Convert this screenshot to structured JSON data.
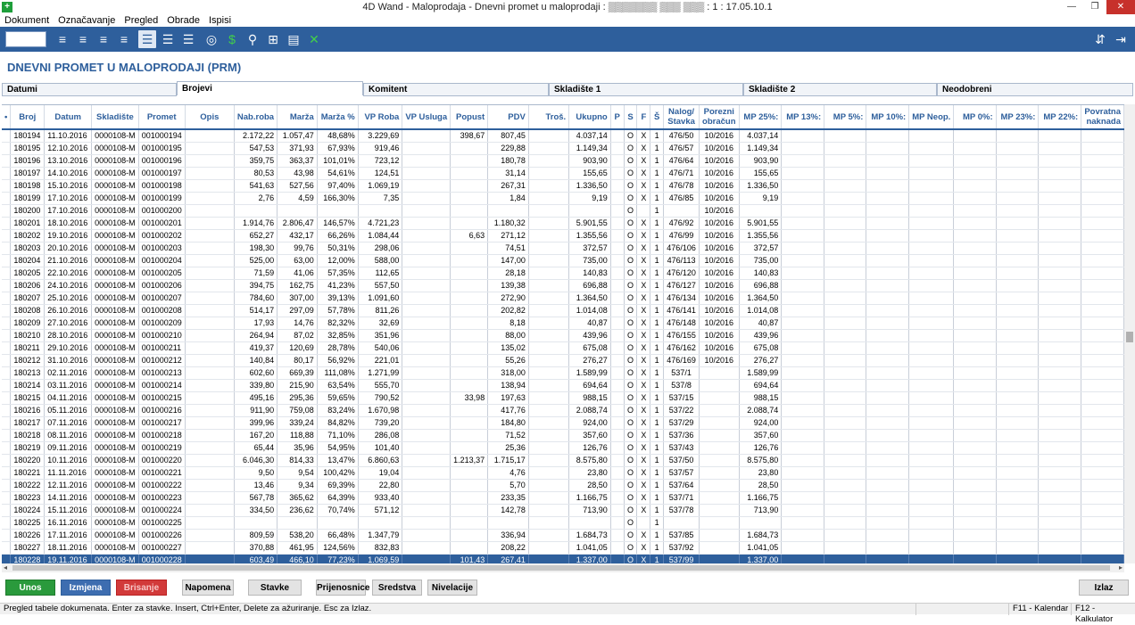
{
  "window": {
    "title": "4D Wand - Maloprodaja - Dnevni promet u maloprodaji : ▒▒▒▒▒▒▒ ▒▒▒ ▒▒▒ : 1 : 17.05.10.1"
  },
  "menu": [
    "Dokument",
    "Označavanje",
    "Pregled",
    "Obrade",
    "Ispisi"
  ],
  "page_title": "DNEVNI PROMET U MALOPRODAJI (PRM)",
  "tabs": [
    {
      "label": "Datumi",
      "w": 196
    },
    {
      "label": "Brojevi",
      "w": 209,
      "active": true
    },
    {
      "label": "Komitent",
      "w": 208
    },
    {
      "label": "Skladište 1",
      "w": 218
    },
    {
      "label": "Skladište 2",
      "w": 217
    },
    {
      "label": "Neodobreni",
      "w": 220
    }
  ],
  "columns": [
    {
      "label": "•",
      "w": 9
    },
    {
      "label": "Broj",
      "w": 38
    },
    {
      "label": "Datum",
      "w": 53
    },
    {
      "label": "Skladište",
      "w": 48
    },
    {
      "label": "Promet",
      "w": 49
    },
    {
      "label": "Opis",
      "w": 58
    },
    {
      "label": "Nab.roba",
      "w": 48
    },
    {
      "label": "Marža",
      "w": 45
    },
    {
      "label": "Marža %",
      "w": 46
    },
    {
      "label": "VP Roba",
      "w": 50
    },
    {
      "label": "VP Usluga",
      "w": 46
    },
    {
      "label": "Popust",
      "w": 41
    },
    {
      "label": "PDV",
      "w": 46
    },
    {
      "label": "Troš.",
      "w": 47
    },
    {
      "label": "Ukupno",
      "w": 47
    },
    {
      "label": "P",
      "w": 15
    },
    {
      "label": "S",
      "w": 15
    },
    {
      "label": "F",
      "w": 15
    },
    {
      "label": "Š",
      "w": 15
    },
    {
      "label": "Nalog/\nStavka",
      "w": 40
    },
    {
      "label": "Porezni\nobračun",
      "w": 42
    },
    {
      "label": "MP 25%:",
      "w": 48
    },
    {
      "label": "MP 13%:",
      "w": 48
    },
    {
      "label": "MP 5%:",
      "w": 48
    },
    {
      "label": "MP 10%:",
      "w": 48
    },
    {
      "label": "MP Neop.",
      "w": 48
    },
    {
      "label": "MP 0%:",
      "w": 48
    },
    {
      "label": "MP 23%:",
      "w": 48
    },
    {
      "label": "MP 22%:",
      "w": 48
    },
    {
      "label": "Povratna\nnaknada",
      "w": 46
    }
  ],
  "rows": [
    [
      "180194",
      "11.10.2016",
      "0000108-M",
      "001000194",
      "",
      "2.172,22",
      "1.057,47",
      "48,68%",
      "3.229,69",
      "",
      "398,67",
      "807,45",
      "",
      "4.037,14",
      "",
      "O",
      "X",
      "1",
      "476/50",
      "10/2016",
      "4.037,14"
    ],
    [
      "180195",
      "12.10.2016",
      "0000108-M",
      "001000195",
      "",
      "547,53",
      "371,93",
      "67,93%",
      "919,46",
      "",
      "",
      "229,88",
      "",
      "1.149,34",
      "",
      "O",
      "X",
      "1",
      "476/57",
      "10/2016",
      "1.149,34"
    ],
    [
      "180196",
      "13.10.2016",
      "0000108-M",
      "001000196",
      "",
      "359,75",
      "363,37",
      "101,01%",
      "723,12",
      "",
      "",
      "180,78",
      "",
      "903,90",
      "",
      "O",
      "X",
      "1",
      "476/64",
      "10/2016",
      "903,90"
    ],
    [
      "180197",
      "14.10.2016",
      "0000108-M",
      "001000197",
      "",
      "80,53",
      "43,98",
      "54,61%",
      "124,51",
      "",
      "",
      "31,14",
      "",
      "155,65",
      "",
      "O",
      "X",
      "1",
      "476/71",
      "10/2016",
      "155,65"
    ],
    [
      "180198",
      "15.10.2016",
      "0000108-M",
      "001000198",
      "",
      "541,63",
      "527,56",
      "97,40%",
      "1.069,19",
      "",
      "",
      "267,31",
      "",
      "1.336,50",
      "",
      "O",
      "X",
      "1",
      "476/78",
      "10/2016",
      "1.336,50"
    ],
    [
      "180199",
      "17.10.2016",
      "0000108-M",
      "001000199",
      "",
      "2,76",
      "4,59",
      "166,30%",
      "7,35",
      "",
      "",
      "1,84",
      "",
      "9,19",
      "",
      "O",
      "X",
      "1",
      "476/85",
      "10/2016",
      "9,19"
    ],
    [
      "180200",
      "17.10.2016",
      "0000108-M",
      "001000200",
      "",
      "",
      "",
      "",
      "",
      "",
      "",
      "",
      "",
      "",
      "",
      "O",
      "",
      "1",
      "",
      "10/2016",
      ""
    ],
    [
      "180201",
      "18.10.2016",
      "0000108-M",
      "001000201",
      "",
      "1.914,76",
      "2.806,47",
      "146,57%",
      "4.721,23",
      "",
      "",
      "1.180,32",
      "",
      "5.901,55",
      "",
      "O",
      "X",
      "1",
      "476/92",
      "10/2016",
      "5.901,55"
    ],
    [
      "180202",
      "19.10.2016",
      "0000108-M",
      "001000202",
      "",
      "652,27",
      "432,17",
      "66,26%",
      "1.084,44",
      "",
      "6,63",
      "271,12",
      "",
      "1.355,56",
      "",
      "O",
      "X",
      "1",
      "476/99",
      "10/2016",
      "1.355,56"
    ],
    [
      "180203",
      "20.10.2016",
      "0000108-M",
      "001000203",
      "",
      "198,30",
      "99,76",
      "50,31%",
      "298,06",
      "",
      "",
      "74,51",
      "",
      "372,57",
      "",
      "O",
      "X",
      "1",
      "476/106",
      "10/2016",
      "372,57"
    ],
    [
      "180204",
      "21.10.2016",
      "0000108-M",
      "001000204",
      "",
      "525,00",
      "63,00",
      "12,00%",
      "588,00",
      "",
      "",
      "147,00",
      "",
      "735,00",
      "",
      "O",
      "X",
      "1",
      "476/113",
      "10/2016",
      "735,00"
    ],
    [
      "180205",
      "22.10.2016",
      "0000108-M",
      "001000205",
      "",
      "71,59",
      "41,06",
      "57,35%",
      "112,65",
      "",
      "",
      "28,18",
      "",
      "140,83",
      "",
      "O",
      "X",
      "1",
      "476/120",
      "10/2016",
      "140,83"
    ],
    [
      "180206",
      "24.10.2016",
      "0000108-M",
      "001000206",
      "",
      "394,75",
      "162,75",
      "41,23%",
      "557,50",
      "",
      "",
      "139,38",
      "",
      "696,88",
      "",
      "O",
      "X",
      "1",
      "476/127",
      "10/2016",
      "696,88"
    ],
    [
      "180207",
      "25.10.2016",
      "0000108-M",
      "001000207",
      "",
      "784,60",
      "307,00",
      "39,13%",
      "1.091,60",
      "",
      "",
      "272,90",
      "",
      "1.364,50",
      "",
      "O",
      "X",
      "1",
      "476/134",
      "10/2016",
      "1.364,50"
    ],
    [
      "180208",
      "26.10.2016",
      "0000108-M",
      "001000208",
      "",
      "514,17",
      "297,09",
      "57,78%",
      "811,26",
      "",
      "",
      "202,82",
      "",
      "1.014,08",
      "",
      "O",
      "X",
      "1",
      "476/141",
      "10/2016",
      "1.014,08"
    ],
    [
      "180209",
      "27.10.2016",
      "0000108-M",
      "001000209",
      "",
      "17,93",
      "14,76",
      "82,32%",
      "32,69",
      "",
      "",
      "8,18",
      "",
      "40,87",
      "",
      "O",
      "X",
      "1",
      "476/148",
      "10/2016",
      "40,87"
    ],
    [
      "180210",
      "28.10.2016",
      "0000108-M",
      "001000210",
      "",
      "264,94",
      "87,02",
      "32,85%",
      "351,96",
      "",
      "",
      "88,00",
      "",
      "439,96",
      "",
      "O",
      "X",
      "1",
      "476/155",
      "10/2016",
      "439,96"
    ],
    [
      "180211",
      "29.10.2016",
      "0000108-M",
      "001000211",
      "",
      "419,37",
      "120,69",
      "28,78%",
      "540,06",
      "",
      "",
      "135,02",
      "",
      "675,08",
      "",
      "O",
      "X",
      "1",
      "476/162",
      "10/2016",
      "675,08"
    ],
    [
      "180212",
      "31.10.2016",
      "0000108-M",
      "001000212",
      "",
      "140,84",
      "80,17",
      "56,92%",
      "221,01",
      "",
      "",
      "55,26",
      "",
      "276,27",
      "",
      "O",
      "X",
      "1",
      "476/169",
      "10/2016",
      "276,27"
    ],
    [
      "180213",
      "02.11.2016",
      "0000108-M",
      "001000213",
      "",
      "602,60",
      "669,39",
      "111,08%",
      "1.271,99",
      "",
      "",
      "318,00",
      "",
      "1.589,99",
      "",
      "O",
      "X",
      "1",
      "537/1",
      "",
      "1.589,99"
    ],
    [
      "180214",
      "03.11.2016",
      "0000108-M",
      "001000214",
      "",
      "339,80",
      "215,90",
      "63,54%",
      "555,70",
      "",
      "",
      "138,94",
      "",
      "694,64",
      "",
      "O",
      "X",
      "1",
      "537/8",
      "",
      "694,64"
    ],
    [
      "180215",
      "04.11.2016",
      "0000108-M",
      "001000215",
      "",
      "495,16",
      "295,36",
      "59,65%",
      "790,52",
      "",
      "33,98",
      "197,63",
      "",
      "988,15",
      "",
      "O",
      "X",
      "1",
      "537/15",
      "",
      "988,15"
    ],
    [
      "180216",
      "05.11.2016",
      "0000108-M",
      "001000216",
      "",
      "911,90",
      "759,08",
      "83,24%",
      "1.670,98",
      "",
      "",
      "417,76",
      "",
      "2.088,74",
      "",
      "O",
      "X",
      "1",
      "537/22",
      "",
      "2.088,74"
    ],
    [
      "180217",
      "07.11.2016",
      "0000108-M",
      "001000217",
      "",
      "399,96",
      "339,24",
      "84,82%",
      "739,20",
      "",
      "",
      "184,80",
      "",
      "924,00",
      "",
      "O",
      "X",
      "1",
      "537/29",
      "",
      "924,00"
    ],
    [
      "180218",
      "08.11.2016",
      "0000108-M",
      "001000218",
      "",
      "167,20",
      "118,88",
      "71,10%",
      "286,08",
      "",
      "",
      "71,52",
      "",
      "357,60",
      "",
      "O",
      "X",
      "1",
      "537/36",
      "",
      "357,60"
    ],
    [
      "180219",
      "09.11.2016",
      "0000108-M",
      "001000219",
      "",
      "65,44",
      "35,96",
      "54,95%",
      "101,40",
      "",
      "",
      "25,36",
      "",
      "126,76",
      "",
      "O",
      "X",
      "1",
      "537/43",
      "",
      "126,76"
    ],
    [
      "180220",
      "10.11.2016",
      "0000108-M",
      "001000220",
      "",
      "6.046,30",
      "814,33",
      "13,47%",
      "6.860,63",
      "",
      "1.213,37",
      "1.715,17",
      "",
      "8.575,80",
      "",
      "O",
      "X",
      "1",
      "537/50",
      "",
      "8.575,80"
    ],
    [
      "180221",
      "11.11.2016",
      "0000108-M",
      "001000221",
      "",
      "9,50",
      "9,54",
      "100,42%",
      "19,04",
      "",
      "",
      "4,76",
      "",
      "23,80",
      "",
      "O",
      "X",
      "1",
      "537/57",
      "",
      "23,80"
    ],
    [
      "180222",
      "12.11.2016",
      "0000108-M",
      "001000222",
      "",
      "13,46",
      "9,34",
      "69,39%",
      "22,80",
      "",
      "",
      "5,70",
      "",
      "28,50",
      "",
      "O",
      "X",
      "1",
      "537/64",
      "",
      "28,50"
    ],
    [
      "180223",
      "14.11.2016",
      "0000108-M",
      "001000223",
      "",
      "567,78",
      "365,62",
      "64,39%",
      "933,40",
      "",
      "",
      "233,35",
      "",
      "1.166,75",
      "",
      "O",
      "X",
      "1",
      "537/71",
      "",
      "1.166,75"
    ],
    [
      "180224",
      "15.11.2016",
      "0000108-M",
      "001000224",
      "",
      "334,50",
      "236,62",
      "70,74%",
      "571,12",
      "",
      "",
      "142,78",
      "",
      "713,90",
      "",
      "O",
      "X",
      "1",
      "537/78",
      "",
      "713,90"
    ],
    [
      "180225",
      "16.11.2016",
      "0000108-M",
      "001000225",
      "",
      "",
      "",
      "",
      "",
      "",
      "",
      "",
      "",
      "",
      "",
      "O",
      "",
      "1",
      "",
      "",
      ""
    ],
    [
      "180226",
      "17.11.2016",
      "0000108-M",
      "001000226",
      "",
      "809,59",
      "538,20",
      "66,48%",
      "1.347,79",
      "",
      "",
      "336,94",
      "",
      "1.684,73",
      "",
      "O",
      "X",
      "1",
      "537/85",
      "",
      "1.684,73"
    ],
    [
      "180227",
      "18.11.2016",
      "0000108-M",
      "001000227",
      "",
      "370,88",
      "461,95",
      "124,56%",
      "832,83",
      "",
      "",
      "208,22",
      "",
      "1.041,05",
      "",
      "O",
      "X",
      "1",
      "537/92",
      "",
      "1.041,05"
    ],
    [
      "180228",
      "19.11.2016",
      "0000108-M",
      "001000228",
      "",
      "603,49",
      "466,10",
      "77,23%",
      "1.069,59",
      "",
      "101,43",
      "267,41",
      "",
      "1.337,00",
      "",
      "O",
      "X",
      "1",
      "537/99",
      "",
      "1.337,00"
    ]
  ],
  "selected_row": 34,
  "buttons": {
    "unos": "Unos",
    "izmjena": "Izmjena",
    "brisanje": "Brisanje",
    "napomena": "Napomena",
    "stavke": "Stavke",
    "prijenosnice": "Prijenosnice",
    "sredstva": "Sredstva",
    "nivelacije": "Nivelacije",
    "izlaz": "Izlaz"
  },
  "status": {
    "message": "Pregled tabele dokumenata. Enter za stavke. Insert, Ctrl+Enter, Delete za ažuriranje. Esc za Izlaz.",
    "f11": "F11 - Kalendar",
    "f12": "F12 - Kalkulator"
  },
  "colors": {
    "accent": "#2e5f9c",
    "unos": "#2a9a3c",
    "brisanje": "#d23a3a"
  }
}
